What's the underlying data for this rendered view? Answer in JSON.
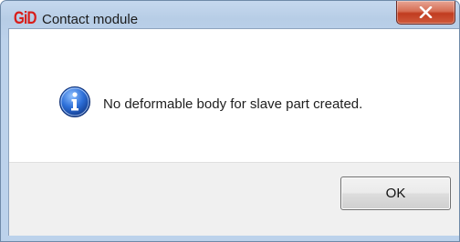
{
  "window": {
    "app_logo_text": "GiD",
    "title": "Contact module",
    "close_symbol": "X"
  },
  "dialog": {
    "icon": "info-icon",
    "message": "No deformable body for slave part created.",
    "ok_label": "OK"
  },
  "colors": {
    "logo_red": "#d81d19",
    "info_blue": "#1f5fc9",
    "close_red": "#c13c20",
    "footer_gray": "#f0f0f0"
  }
}
